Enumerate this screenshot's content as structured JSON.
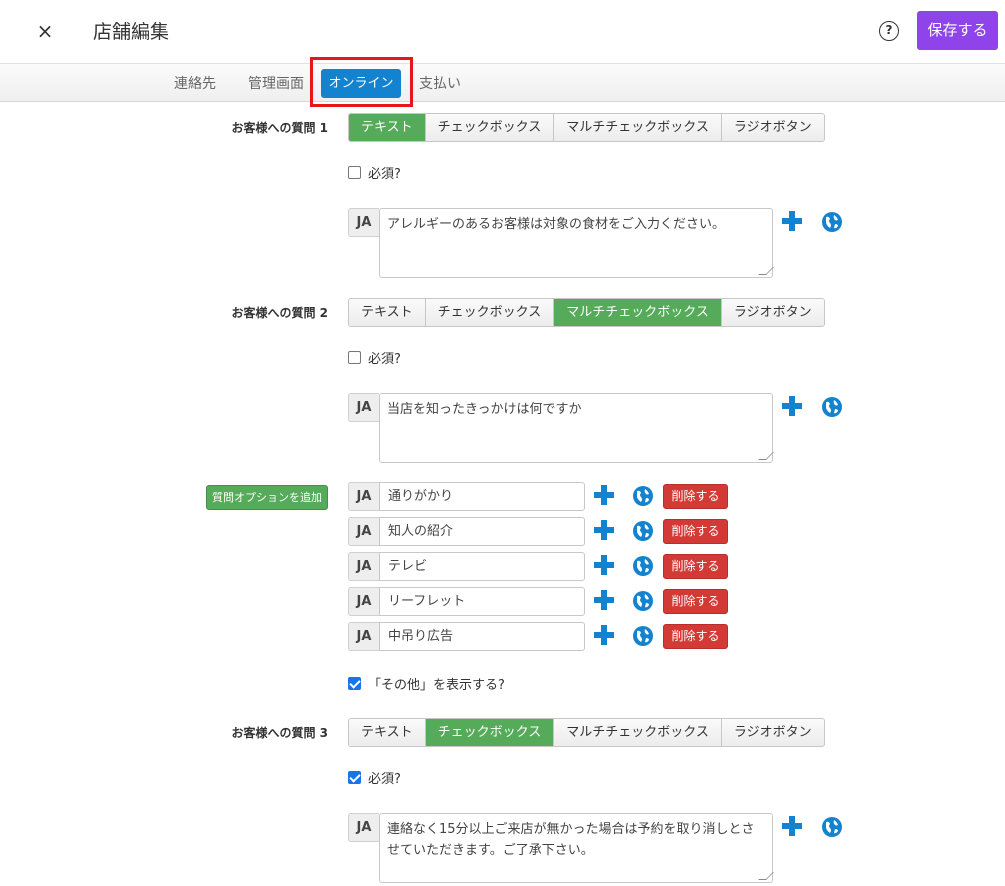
{
  "header": {
    "close_glyph": "×",
    "title": "店舗編集",
    "help_glyph": "?",
    "save_label": "保存する"
  },
  "tabs": [
    {
      "label": "連絡先",
      "active": false
    },
    {
      "label": "管理画面",
      "active": false
    },
    {
      "label": "オンライン",
      "active": true
    },
    {
      "label": "支払い",
      "active": false
    }
  ],
  "type_options": [
    "テキスト",
    "チェックボックス",
    "マルチチェックボックス",
    "ラジオボタン"
  ],
  "questions": [
    {
      "label": "お客様への質問 1",
      "selected_type": "テキスト",
      "required_label": "必須?",
      "required": false,
      "lang": "JA",
      "text": "アレルギーのあるお客様は対象の食材をご入力ください。"
    },
    {
      "label": "お客様への質問 2",
      "selected_type": "マルチチェックボックス",
      "required_label": "必須?",
      "required": false,
      "lang": "JA",
      "text": "当店を知ったきっかけは何ですか"
    },
    {
      "label": "お客様への質問 3",
      "selected_type": "チェックボックス",
      "required_label": "必須?",
      "required": true,
      "lang": "JA",
      "text": "連絡なく15分以上ご来店が無かった場合は予約を取り消しとさせていただきます。ご了承下さい。"
    }
  ],
  "options": {
    "add_label": "質問オプションを追加",
    "delete_label": "削除する",
    "lang": "JA",
    "items": [
      "通りがかり",
      "知人の紹介",
      "テレビ",
      "リーフレット",
      "中吊り広告"
    ]
  },
  "other": {
    "label": "「その他」を表示する?",
    "checked": true
  },
  "icons": {
    "add": "plus-icon",
    "translate": "globe-icon"
  },
  "colors": {
    "accent_purple": "#8e44e8",
    "tab_active": "#1483cf",
    "selected_green": "#55ab5a",
    "delete_red": "#d33a36",
    "highlight_red": "#e5161c"
  }
}
